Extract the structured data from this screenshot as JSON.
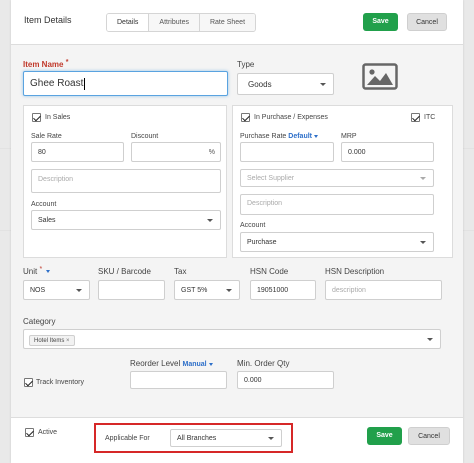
{
  "header": {
    "title": "Item Details",
    "tabs": [
      "Details",
      "Attributes",
      "Rate Sheet"
    ],
    "save_label": "Save",
    "cancel_label": "Cancel"
  },
  "item": {
    "name_label": "Item Name",
    "required_mark": "*",
    "name_value": "Ghee Roast",
    "type_label": "Type",
    "type_value": "Goods",
    "image_icon": "image-placeholder-icon"
  },
  "sales": {
    "checkbox_label": "In Sales",
    "checked": true,
    "rate_label": "Sale Rate",
    "rate_value": "80",
    "discount_label": "Discount",
    "discount_value": "",
    "discount_unit": "%",
    "description_placeholder": "Description",
    "account_label": "Account",
    "account_value": "Sales"
  },
  "purchase": {
    "checkbox_label": "In Purchase / Expenses",
    "checked": true,
    "itc_label": "ITC",
    "itc_checked": true,
    "rate_label": "Purchase Rate",
    "rate_mode": "Default",
    "rate_value": "",
    "mrp_label": "MRP",
    "mrp_value": "0.000",
    "supplier_placeholder": "Select Supplier",
    "description_placeholder": "Description",
    "account_label": "Account",
    "account_value": "Purchase"
  },
  "attributes": {
    "unit_label": "Unit",
    "unit_required": "*",
    "unit_value": "NOS",
    "sku_label": "SKU / Barcode",
    "sku_value": "",
    "tax_label": "Tax",
    "tax_value": "GST 5%",
    "hsn_label": "HSN Code",
    "hsn_value": "19051000",
    "hsn_desc_label": "HSN Description",
    "hsn_desc_placeholder": "description"
  },
  "category": {
    "label": "Category",
    "tags": [
      "Hotel Items"
    ],
    "remove_glyph": "×"
  },
  "inventory": {
    "track_label": "Track Inventory",
    "track_checked": true,
    "reorder_label": "Reorder Level",
    "reorder_mode": "Manual",
    "reorder_value": "",
    "min_qty_label": "Min. Order Qty",
    "min_qty_value": "0.000"
  },
  "footer": {
    "active_label": "Active",
    "active_checked": true,
    "applicable_label": "Applicable For",
    "applicable_value": "All Branches",
    "save_label": "Save",
    "cancel_label": "Cancel"
  },
  "colors": {
    "save_green": "#21a04b",
    "link_blue": "#2d6fc9",
    "highlight_red": "#d62828",
    "required_red": "#c0392b"
  }
}
